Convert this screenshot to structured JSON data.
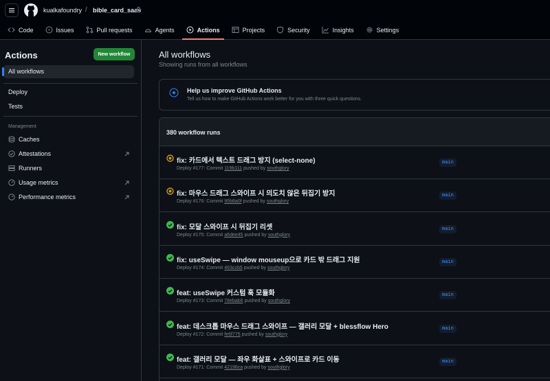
{
  "header": {
    "owner": "kualkafoundry",
    "separator": "/",
    "repo": "bible_card_saas"
  },
  "nav": [
    {
      "label": "Code",
      "icon": "code-icon"
    },
    {
      "label": "Issues",
      "icon": "issue-icon"
    },
    {
      "label": "Pull requests",
      "icon": "pull-request-icon"
    },
    {
      "label": "Agents",
      "icon": "agents-icon"
    },
    {
      "label": "Actions",
      "icon": "play-icon",
      "active": true
    },
    {
      "label": "Projects",
      "icon": "table-icon"
    },
    {
      "label": "Security",
      "icon": "shield-icon"
    },
    {
      "label": "Insights",
      "icon": "graph-icon"
    },
    {
      "label": "Settings",
      "icon": "gear-icon"
    }
  ],
  "sidebar": {
    "title": "Actions",
    "new_workflow": "New workflow",
    "all_workflows": "All workflows",
    "workflows": [
      "Deploy",
      "Tests"
    ],
    "management_label": "Management",
    "management": [
      {
        "label": "Caches",
        "icon": "cache-icon"
      },
      {
        "label": "Attestations",
        "icon": "check-circle-icon"
      },
      {
        "label": "Runners",
        "icon": "server-icon"
      },
      {
        "label": "Usage metrics",
        "icon": "meter-icon"
      },
      {
        "label": "Performance metrics",
        "icon": "meter-icon"
      }
    ]
  },
  "main": {
    "title": "All workflows",
    "subtitle": "Showing runs from all workflows",
    "banner_title": "Help us improve GitHub Actions",
    "banner_text": "Tell us how to make GitHub Actions work better for you with three quick questions.",
    "runs_count": "380 workflow runs"
  },
  "runs": [
    {
      "title": "fix: 카드에서 텍스트 드래그 방지 (select-none)",
      "status": "in-progress",
      "workflow": "Deploy",
      "run": "#177",
      "commit": "119b111",
      "pushed_by": "pushed by",
      "user": "southglory",
      "branch": "main"
    },
    {
      "title": "fix: 마우스 드래그 스와이프 시 의도치 않은 뒤집기 방지",
      "status": "in-progress",
      "workflow": "Deploy",
      "run": "#176",
      "commit": "95b8a0f",
      "pushed_by": "pushed by",
      "user": "southglory",
      "branch": "main"
    },
    {
      "title": "fix: 모달 스와이프 시 뒤집기 리셋",
      "status": "success",
      "workflow": "Deploy",
      "run": "#175",
      "commit": "a6dee45",
      "pushed_by": "pushed by",
      "user": "southglory",
      "branch": "main"
    },
    {
      "title": "fix: useSwipe — window mouseup으로 카드 밖 드래그 지원",
      "status": "success",
      "workflow": "Deploy",
      "run": "#174",
      "commit": "463ccb5",
      "pushed_by": "pushed by",
      "user": "southglory",
      "branch": "main"
    },
    {
      "title": "feat: useSwipe 커스텀 훅 모듈화",
      "status": "success",
      "workflow": "Deploy",
      "run": "#173",
      "commit": "78ebab6",
      "pushed_by": "pushed by",
      "user": "southglory",
      "branch": "main"
    },
    {
      "title": "feat: 데스크톱 마우스 드래그 스와이프 — 갤러리 모달 + blessflow Hero",
      "status": "success",
      "workflow": "Deploy",
      "run": "#172",
      "commit": "fe6f775",
      "pushed_by": "pushed by",
      "user": "southglory",
      "branch": "main"
    },
    {
      "title": "feat: 갤러리 모달 — 좌우 화살표 + 스와이프로 카드 이동",
      "status": "success",
      "workflow": "Deploy",
      "run": "#171",
      "commit": "42196ca",
      "pushed_by": "pushed by",
      "user": "southglory",
      "branch": "main"
    }
  ],
  "colors": {
    "success": "#3fb950",
    "in_progress": "#d29922",
    "accent": "#2f81f7",
    "new_button": "#238636"
  }
}
